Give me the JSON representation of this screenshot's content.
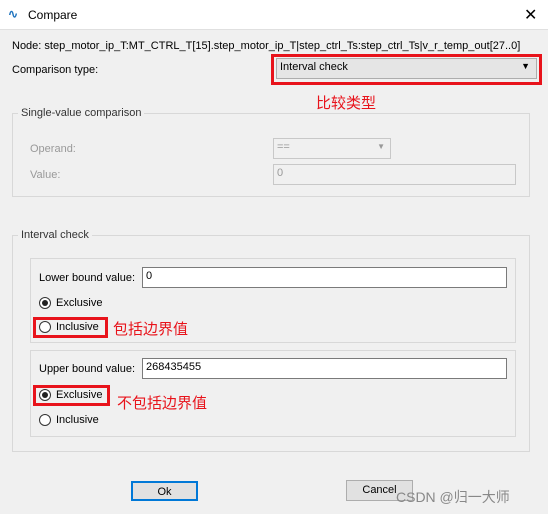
{
  "window": {
    "title": "Compare",
    "close_icon": "close-icon",
    "app_icon": "waveform-icon"
  },
  "node_label": "Node:  step_motor_ip_T:MT_CTRL_T[15].step_motor_ip_T|step_ctrl_Ts:step_ctrl_Ts|v_r_temp_out[27..0]",
  "comparison_type": {
    "label": "Comparison type:",
    "value": "Interval check",
    "annotation": "比较类型"
  },
  "single_value": {
    "title": "Single-value comparison",
    "operand_label": "Operand:",
    "operand_value": "==",
    "value_label": "Value:",
    "value": "0"
  },
  "interval": {
    "title": "Interval check",
    "lower": {
      "label": "Lower bound value:",
      "value": "0",
      "exclusive": "Exclusive",
      "inclusive": "Inclusive",
      "selected": "Exclusive",
      "annotation": "包括边界值"
    },
    "upper": {
      "label": "Upper bound value:",
      "value": "268435455",
      "exclusive": "Exclusive",
      "inclusive": "Inclusive",
      "selected": "Exclusive",
      "annotation": "不包括边界值"
    }
  },
  "buttons": {
    "ok": "Ok",
    "cancel": "Cancel"
  },
  "watermark": "CSDN @归一大师",
  "colors": {
    "annotation": "#e8131b",
    "focus": "#0078d7"
  }
}
